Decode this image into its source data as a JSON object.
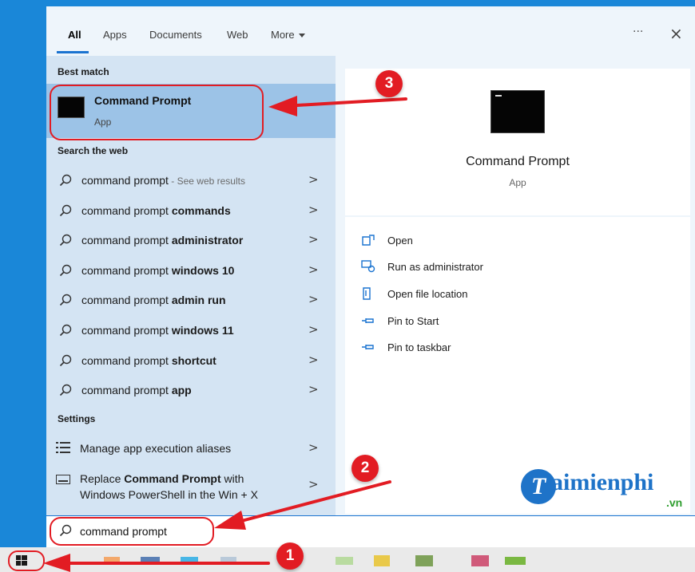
{
  "tabs": [
    {
      "label": "All",
      "active": true
    },
    {
      "label": "Apps",
      "active": false
    },
    {
      "label": "Documents",
      "active": false
    },
    {
      "label": "Web",
      "active": false
    },
    {
      "label": "More",
      "active": false
    }
  ],
  "header_icons": {
    "ellipsis": "···",
    "close": "×"
  },
  "best_match": {
    "header": "Best match",
    "title": "Command Prompt",
    "subtitle": "App"
  },
  "search_web": {
    "header": "Search the web",
    "items": [
      {
        "prefix": "command prompt",
        "bold": "",
        "suffix": " - See web results"
      },
      {
        "prefix": "command prompt ",
        "bold": "commands",
        "suffix": ""
      },
      {
        "prefix": "command prompt ",
        "bold": "administrator",
        "suffix": ""
      },
      {
        "prefix": "command prompt ",
        "bold": "windows 10",
        "suffix": ""
      },
      {
        "prefix": "command prompt ",
        "bold": "admin run",
        "suffix": ""
      },
      {
        "prefix": "command prompt ",
        "bold": "windows 11",
        "suffix": ""
      },
      {
        "prefix": "command prompt ",
        "bold": "shortcut",
        "suffix": ""
      },
      {
        "prefix": "command prompt ",
        "bold": "app",
        "suffix": ""
      }
    ]
  },
  "settings": {
    "header": "Settings",
    "item1": "Manage app execution aliases",
    "item2_pre": "Replace ",
    "item2_bold": "Command Prompt",
    "item2_post": " with",
    "item2_line2": "Windows PowerShell in the Win + X"
  },
  "preview": {
    "title": "Command Prompt",
    "subtitle": "App"
  },
  "actions": [
    {
      "label": "Open",
      "icon": "open-icon"
    },
    {
      "label": "Run as administrator",
      "icon": "shield-run-icon"
    },
    {
      "label": "Open file location",
      "icon": "folder-location-icon"
    },
    {
      "label": "Pin to Start",
      "icon": "pin-icon"
    },
    {
      "label": "Pin to taskbar",
      "icon": "pin-icon"
    }
  ],
  "search": {
    "value": "command prompt"
  },
  "callouts": {
    "one": "1",
    "two": "2",
    "three": "3"
  },
  "watermark": {
    "brand": "Taimienphi",
    "letter": "T",
    "text": "aimienphi",
    "tld": ".vn"
  },
  "colors": {
    "accent": "#1a73d0",
    "highlight": "#9cc3e7",
    "pane": "#d4e4f3",
    "callout": "#e21c23"
  }
}
